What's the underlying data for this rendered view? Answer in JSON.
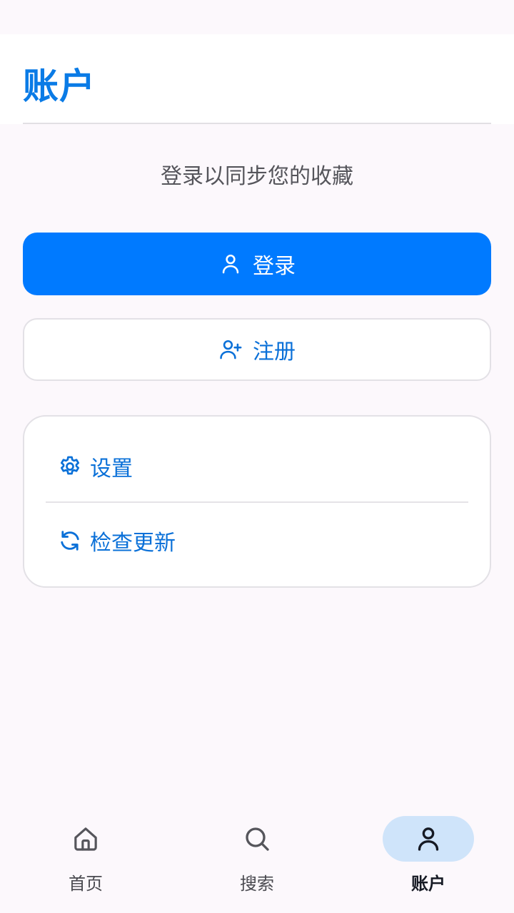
{
  "header": {
    "title": "账户"
  },
  "account": {
    "prompt": "登录以同步您的收藏",
    "login_label": "登录",
    "register_label": "注册"
  },
  "menu": {
    "items": [
      {
        "label": "设置",
        "icon": "gear-icon"
      },
      {
        "label": "检查更新",
        "icon": "refresh-icon"
      }
    ]
  },
  "bottom_nav": {
    "items": [
      {
        "label": "首页",
        "icon": "home-icon",
        "active": false
      },
      {
        "label": "搜索",
        "icon": "search-icon",
        "active": false
      },
      {
        "label": "账户",
        "icon": "person-icon",
        "active": true
      }
    ]
  },
  "colors": {
    "accent": "#007aff",
    "accent_text": "#0a70d8",
    "nav_active_pill": "#cfe4fa"
  }
}
